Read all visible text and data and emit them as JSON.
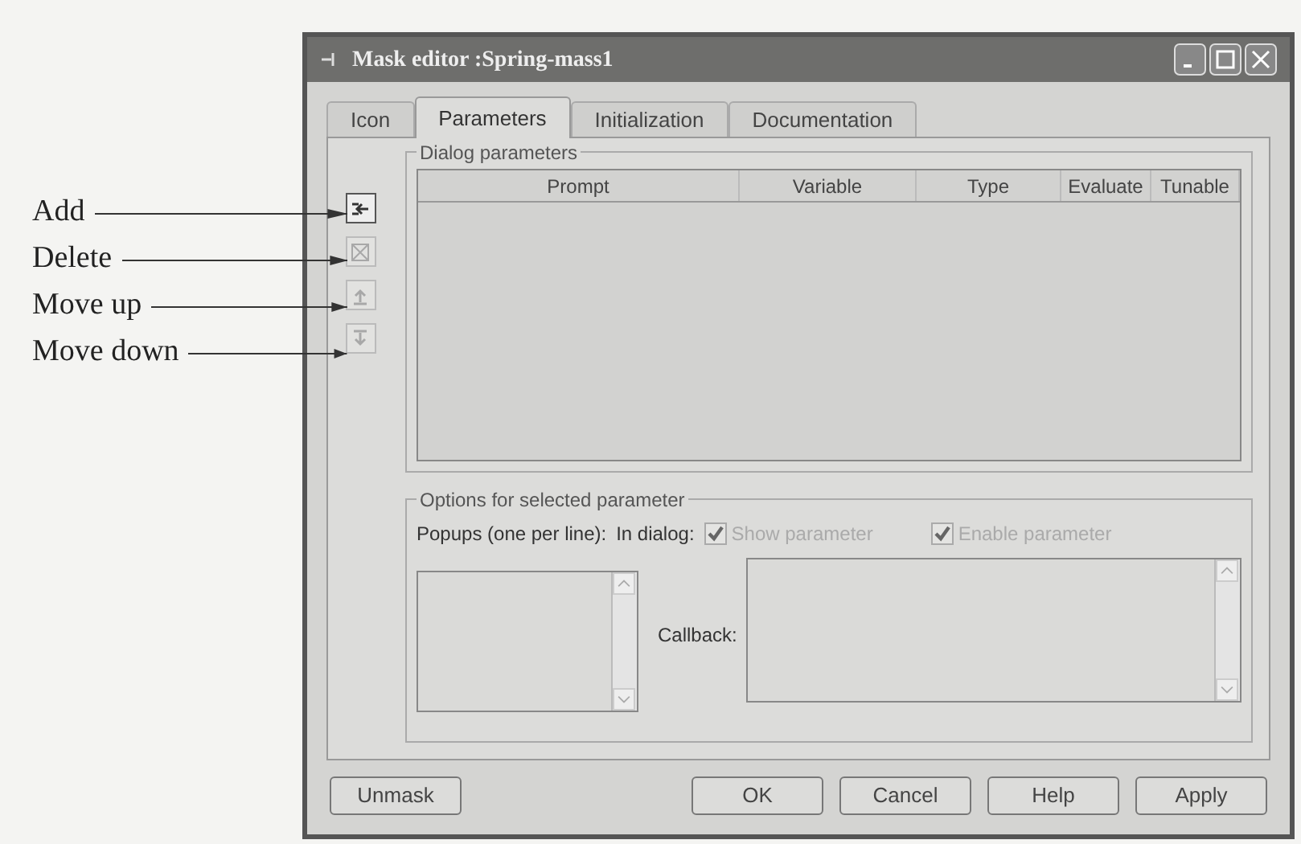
{
  "window": {
    "title": "Mask editor :Spring-mass1"
  },
  "callouts": [
    "Add",
    "Delete",
    "Move up",
    "Move down"
  ],
  "tabs": [
    {
      "label": "Icon",
      "selected": false
    },
    {
      "label": "Parameters",
      "selected": true
    },
    {
      "label": "Initialization",
      "selected": false
    },
    {
      "label": "Documentation",
      "selected": false
    }
  ],
  "toolbar_buttons": [
    {
      "kind": "add",
      "disabled": false
    },
    {
      "kind": "delete",
      "disabled": true
    },
    {
      "kind": "up",
      "disabled": true
    },
    {
      "kind": "down",
      "disabled": true
    }
  ],
  "dialog_parameters": {
    "title": "Dialog parameters",
    "columns": [
      "Prompt",
      "Variable",
      "Type",
      "Evaluate",
      "Tunable"
    ]
  },
  "options": {
    "title": "Options for selected parameter",
    "popups_label": "Popups (one per line):",
    "in_dialog_label": "In dialog:",
    "checkboxes": [
      {
        "label": "Show parameter",
        "checked": true,
        "disabled": true
      },
      {
        "label": "Enable parameter",
        "checked": true,
        "disabled": true
      }
    ],
    "callback_label": "Callback:"
  },
  "unmask_button": "Unmask",
  "buttons": [
    "OK",
    "Cancel",
    "Help",
    "Apply"
  ]
}
